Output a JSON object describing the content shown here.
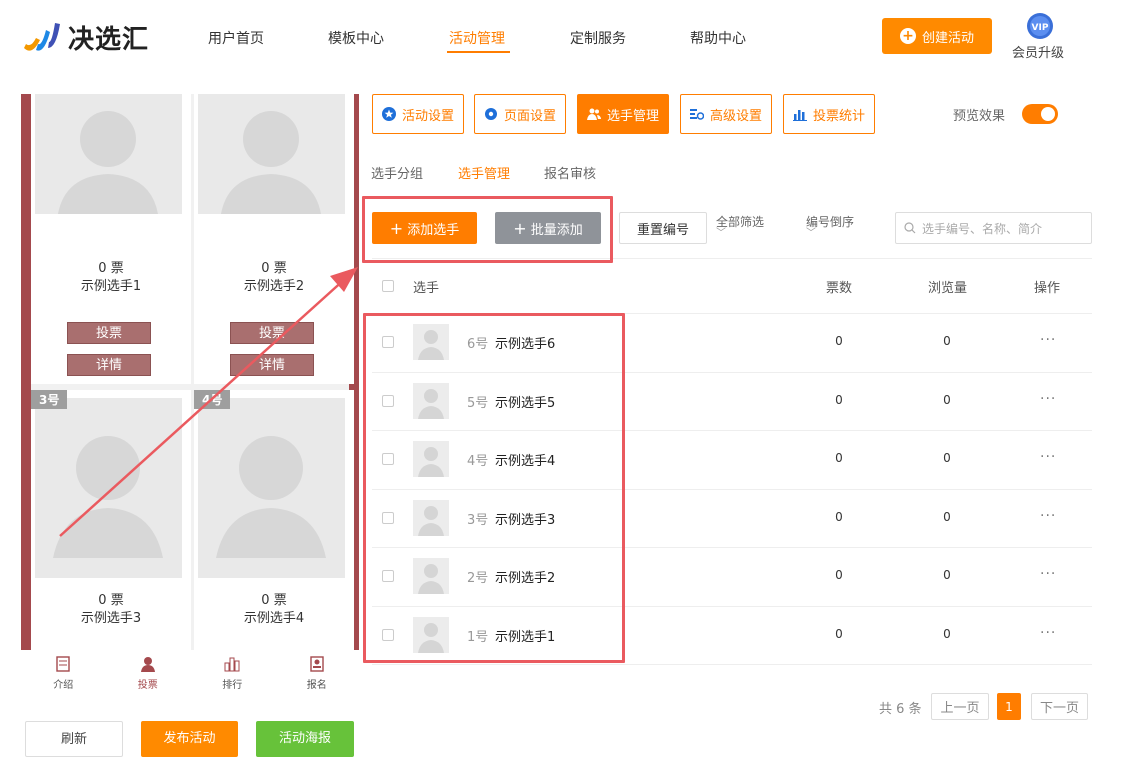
{
  "brand": {
    "name": "决选汇",
    "accent": "#ff7d00"
  },
  "nav": {
    "items": [
      {
        "label": "用户首页"
      },
      {
        "label": "模板中心"
      },
      {
        "label": "活动管理"
      },
      {
        "label": "定制服务"
      },
      {
        "label": "帮助中心"
      }
    ],
    "active": "活动管理"
  },
  "header": {
    "create_label": "创建活动",
    "vip_badge": "VIP",
    "vip_label": "会员升级"
  },
  "preview": {
    "cards": [
      {
        "votes": "0 票",
        "name": "示例选手1",
        "vote_btn": "投票",
        "detail_btn": "详情"
      },
      {
        "votes": "0 票",
        "name": "示例选手2",
        "vote_btn": "投票",
        "detail_btn": "详情"
      },
      {
        "tag": "3号",
        "votes": "0 票",
        "name": "示例选手3"
      },
      {
        "tag": "4号",
        "votes": "0 票",
        "name": "示例选手4"
      }
    ],
    "tabs": [
      {
        "label": "介绍",
        "icon": "doc-icon"
      },
      {
        "label": "投票",
        "icon": "user-icon"
      },
      {
        "label": "排行",
        "icon": "bar-icon"
      },
      {
        "label": "报名",
        "icon": "id-card-icon"
      }
    ],
    "active_tab": "投票"
  },
  "bottom": {
    "refresh": "刷新",
    "publish": "发布活动",
    "poster": "活动海报"
  },
  "tools": [
    {
      "label": "活动设置",
      "icon": "star-icon"
    },
    {
      "label": "页面设置",
      "icon": "gear-icon"
    },
    {
      "label": "选手管理",
      "icon": "users-icon"
    },
    {
      "label": "高级设置",
      "icon": "advanced-icon"
    },
    {
      "label": "投票统计",
      "icon": "chart-icon"
    }
  ],
  "active_tool": "选手管理",
  "preview_toggle": {
    "label": "预览效果",
    "on": true
  },
  "subtabs": [
    {
      "label": "选手分组"
    },
    {
      "label": "选手管理"
    },
    {
      "label": "报名审核"
    }
  ],
  "actions": {
    "add": "添加选手",
    "batch": "批量添加",
    "reset": "重置编号",
    "filter_all": "全部筛选",
    "sort": "编号倒序",
    "search_placeholder": "选手编号、名称、简介"
  },
  "table": {
    "headers": {
      "player": "选手",
      "votes": "票数",
      "views": "浏览量",
      "ops": "操作"
    },
    "rows": [
      {
        "num": "6号",
        "name": "示例选手6",
        "votes": "0",
        "views": "0",
        "ops": "···"
      },
      {
        "num": "5号",
        "name": "示例选手5",
        "votes": "0",
        "views": "0",
        "ops": "···"
      },
      {
        "num": "4号",
        "name": "示例选手4",
        "votes": "0",
        "views": "0",
        "ops": "···"
      },
      {
        "num": "3号",
        "name": "示例选手3",
        "votes": "0",
        "views": "0",
        "ops": "···"
      },
      {
        "num": "2号",
        "name": "示例选手2",
        "votes": "0",
        "views": "0",
        "ops": "···"
      },
      {
        "num": "1号",
        "name": "示例选手1",
        "votes": "0",
        "views": "0",
        "ops": "···"
      }
    ]
  },
  "pager": {
    "total": "共 6 条",
    "prev": "上一页",
    "current": "1",
    "next": "下一页"
  },
  "colors": {
    "preview_bg": "#a4494d",
    "highlight": "#ea5a5f",
    "publish": "#ff8a00",
    "poster": "#67c23a",
    "batch": "#8f9399"
  }
}
